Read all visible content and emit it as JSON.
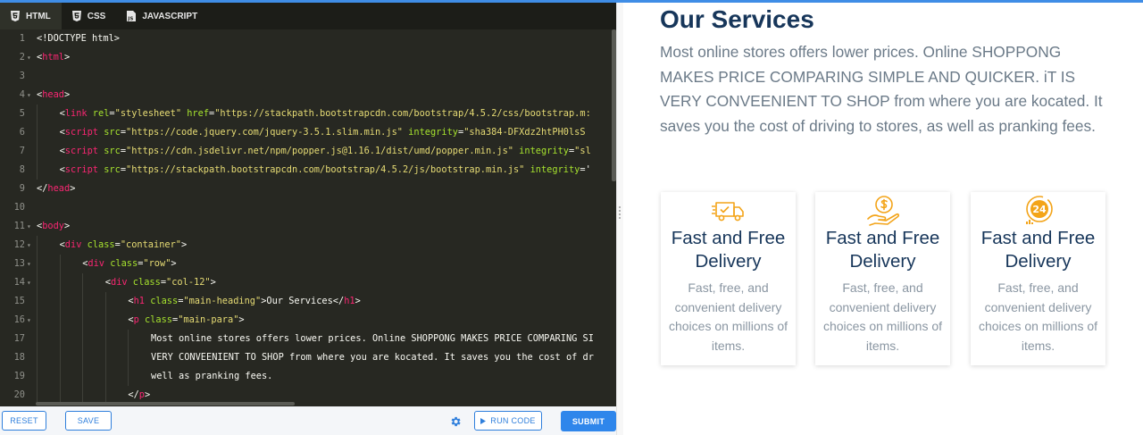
{
  "editor": {
    "tabs": [
      {
        "label": "HTML",
        "icon": "html5-icon"
      },
      {
        "label": "CSS",
        "icon": "css3-icon"
      },
      {
        "label": "JAVASCRIPT",
        "icon": "javascript-icon"
      }
    ],
    "lines": [
      {
        "n": "1",
        "fold": false,
        "segs": [
          [
            "p",
            "<!DOCTYPE html>"
          ]
        ]
      },
      {
        "n": "2",
        "fold": true,
        "segs": [
          [
            "p",
            "<"
          ],
          [
            "t",
            "html"
          ],
          [
            "p",
            ">"
          ]
        ]
      },
      {
        "n": "3",
        "fold": false,
        "segs": []
      },
      {
        "n": "4",
        "fold": true,
        "segs": [
          [
            "p",
            "<"
          ],
          [
            "t",
            "head"
          ],
          [
            "p",
            ">"
          ]
        ]
      },
      {
        "n": "5",
        "fold": false,
        "indent": 1,
        "segs": [
          [
            "p",
            "<"
          ],
          [
            "t",
            "link"
          ],
          [
            "a",
            " rel"
          ],
          [
            "p",
            "="
          ],
          [
            "s",
            "\"stylesheet\""
          ],
          [
            "a",
            " href"
          ],
          [
            "p",
            "="
          ],
          [
            "s",
            "\"https://stackpath.bootstrapcdn.com/bootstrap/4.5.2/css/bootstrap.m:"
          ]
        ]
      },
      {
        "n": "6",
        "fold": false,
        "indent": 1,
        "segs": [
          [
            "p",
            "<"
          ],
          [
            "t",
            "script"
          ],
          [
            "a",
            " src"
          ],
          [
            "p",
            "="
          ],
          [
            "s",
            "\"https://code.jquery.com/jquery-3.5.1.slim.min.js\""
          ],
          [
            "a",
            " integrity"
          ],
          [
            "p",
            "="
          ],
          [
            "s",
            "\"sha384-DFXdz2htPH0lsS"
          ]
        ]
      },
      {
        "n": "7",
        "fold": false,
        "indent": 1,
        "segs": [
          [
            "p",
            "<"
          ],
          [
            "t",
            "script"
          ],
          [
            "a",
            " src"
          ],
          [
            "p",
            "="
          ],
          [
            "s",
            "\"https://cdn.jsdelivr.net/npm/popper.js@1.16.1/dist/umd/popper.min.js\""
          ],
          [
            "a",
            " integrity"
          ],
          [
            "p",
            "="
          ],
          [
            "s",
            "\"sl"
          ]
        ]
      },
      {
        "n": "8",
        "fold": false,
        "indent": 1,
        "segs": [
          [
            "p",
            "<"
          ],
          [
            "t",
            "script"
          ],
          [
            "a",
            " src"
          ],
          [
            "p",
            "="
          ],
          [
            "s",
            "\"https://stackpath.bootstrapcdn.com/bootstrap/4.5.2/js/bootstrap.min.js\""
          ],
          [
            "a",
            " integrity"
          ],
          [
            "p",
            "='"
          ]
        ]
      },
      {
        "n": "9",
        "fold": false,
        "segs": [
          [
            "p",
            "</"
          ],
          [
            "t",
            "head"
          ],
          [
            "p",
            ">"
          ]
        ]
      },
      {
        "n": "10",
        "fold": false,
        "segs": []
      },
      {
        "n": "11",
        "fold": true,
        "segs": [
          [
            "p",
            "<"
          ],
          [
            "t",
            "body"
          ],
          [
            "p",
            ">"
          ]
        ]
      },
      {
        "n": "12",
        "fold": true,
        "indent": 1,
        "segs": [
          [
            "p",
            "<"
          ],
          [
            "t",
            "div"
          ],
          [
            "a",
            " class"
          ],
          [
            "p",
            "="
          ],
          [
            "s",
            "\"container\""
          ],
          [
            "p",
            ">"
          ]
        ]
      },
      {
        "n": "13",
        "fold": true,
        "indent": 2,
        "segs": [
          [
            "p",
            "<"
          ],
          [
            "t",
            "div"
          ],
          [
            "a",
            " class"
          ],
          [
            "p",
            "="
          ],
          [
            "s",
            "\"row\""
          ],
          [
            "p",
            ">"
          ]
        ]
      },
      {
        "n": "14",
        "fold": true,
        "indent": 3,
        "segs": [
          [
            "p",
            "<"
          ],
          [
            "t",
            "div"
          ],
          [
            "a",
            " class"
          ],
          [
            "p",
            "="
          ],
          [
            "s",
            "\"col-12\""
          ],
          [
            "p",
            ">"
          ]
        ]
      },
      {
        "n": "15",
        "fold": false,
        "indent": 4,
        "segs": [
          [
            "p",
            "<"
          ],
          [
            "t",
            "h1"
          ],
          [
            "a",
            " class"
          ],
          [
            "p",
            "="
          ],
          [
            "s",
            "\"main-heading\""
          ],
          [
            "p",
            ">Our Services</"
          ],
          [
            "t",
            "h1"
          ],
          [
            "p",
            ">"
          ]
        ]
      },
      {
        "n": "16",
        "fold": true,
        "indent": 4,
        "segs": [
          [
            "p",
            "<"
          ],
          [
            "t",
            "p"
          ],
          [
            "a",
            " class"
          ],
          [
            "p",
            "="
          ],
          [
            "s",
            "\"main-para\""
          ],
          [
            "p",
            ">"
          ]
        ]
      },
      {
        "n": "17",
        "fold": false,
        "indent": 5,
        "segs": [
          [
            "p",
            "Most online stores offers lower prices. Online SHOPPONG MAKES PRICE COMPARING SI"
          ]
        ]
      },
      {
        "n": "18",
        "fold": false,
        "indent": 5,
        "segs": [
          [
            "p",
            "VERY CONVEENIENT TO SHOP from where you are kocated. It saves you the cost of dr"
          ]
        ]
      },
      {
        "n": "19",
        "fold": false,
        "indent": 5,
        "segs": [
          [
            "p",
            "well as pranking fees."
          ]
        ]
      },
      {
        "n": "20",
        "fold": false,
        "indent": 4,
        "segs": [
          [
            "p",
            "</"
          ],
          [
            "t",
            "p"
          ],
          [
            "p",
            ">"
          ]
        ]
      }
    ]
  },
  "toolbar": {
    "reset_label": "RESET",
    "save_label": "SAVE",
    "run_label": "RUN CODE",
    "submit_label": "SUBMIT"
  },
  "preview": {
    "heading": "Our Services",
    "paragraph": "Most online stores offers lower prices. Online SHOPPONG MAKES PRICE COMPARING SIMPLE AND QUICKER. iT IS VERY CONVEENIENT TO SHOP from where you are kocated. It saves you the cost of driving to stores, as well as pranking fees.",
    "cards": [
      {
        "icon": "delivery-truck-icon",
        "title": "Fast and Free Delivery",
        "text": "Fast, free, and convenient delivery choices on millions of items."
      },
      {
        "icon": "money-hand-icon",
        "title": "Fast and Free Delivery",
        "text": "Fast, free, and convenient delivery choices on millions of items."
      },
      {
        "icon": "24-hours-icon",
        "title": "Fast and Free Delivery",
        "text": "Fast, free, and convenient delivery choices on millions of items."
      }
    ]
  },
  "colors": {
    "accent": "#2f86eb",
    "editor_bg": "#272822",
    "heading": "#17365a",
    "icon_orange": "#f3a419"
  }
}
